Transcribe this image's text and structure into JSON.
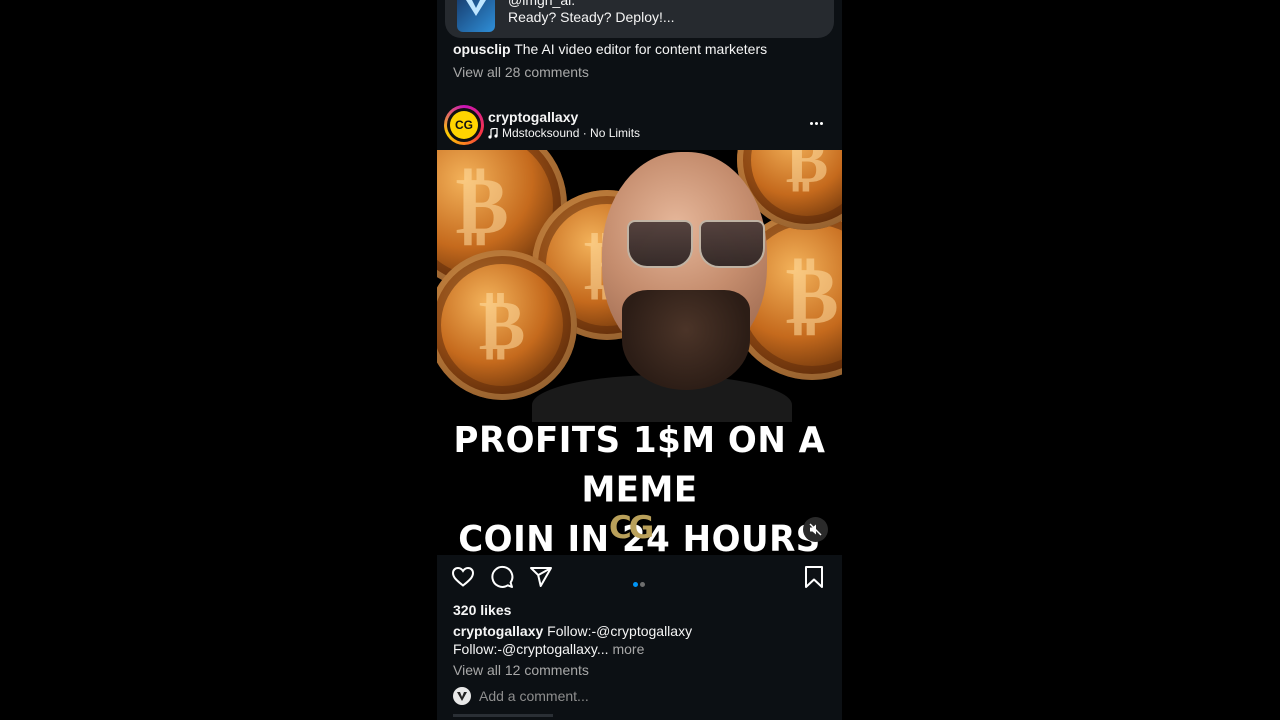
{
  "previous_post": {
    "comment_handle": "@imgn_ai.",
    "comment_text": "Ready? Steady? Deploy!...",
    "caption_user": "opusclip",
    "caption_text": "The AI video editor for content marketers",
    "view_comments": "View all 28 comments"
  },
  "post": {
    "avatar_initials": "CG",
    "username": "cryptogallaxy",
    "audio": "Mdstocksound · No Limits",
    "headline_line1": "PROFITS 1$M ON A MEME",
    "headline_line2": "COIN IN 24 HOURS",
    "watermark": "CG",
    "likes": "320 likes",
    "caption_user": "cryptogallaxy",
    "caption_text": "Follow:-@cryptogallaxy",
    "caption_line2": "Follow:-@cryptogallaxy...",
    "caption_more": "more",
    "view_comments": "View all 12 comments",
    "add_comment_placeholder": "Add a comment..."
  },
  "icons": [
    "heart-icon",
    "comment-icon",
    "share-icon",
    "bookmark-icon",
    "more-icon",
    "music-icon",
    "muted-speaker-icon"
  ],
  "colors": {
    "background": "#0c1014",
    "active_dot": "#0095f6",
    "muted_text": "#a8a8a8"
  }
}
